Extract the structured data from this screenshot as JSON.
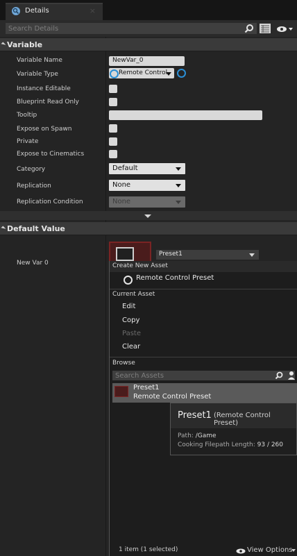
{
  "tab": {
    "label": "Details",
    "close": "×"
  },
  "search": {
    "placeholder": "Search Details"
  },
  "variable_section": {
    "title": "Variable",
    "rows": {
      "variable_name": {
        "label": "Variable Name",
        "value": "NewVar_0"
      },
      "variable_type": {
        "label": "Variable Type",
        "value": "Remote Control"
      },
      "instance_editable": {
        "label": "Instance Editable"
      },
      "blueprint_read_only": {
        "label": "Blueprint Read Only"
      },
      "tooltip": {
        "label": "Tooltip",
        "value": ""
      },
      "expose_on_spawn": {
        "label": "Expose on Spawn"
      },
      "private": {
        "label": "Private"
      },
      "expose_to_cinematics": {
        "label": "Expose to Cinematics"
      },
      "category": {
        "label": "Category",
        "value": "Default"
      },
      "replication": {
        "label": "Replication",
        "value": "None"
      },
      "replication_condition": {
        "label": "Replication Condition",
        "value": "None"
      }
    }
  },
  "default_value_section": {
    "title": "Default Value",
    "new_var": {
      "label": "New Var 0",
      "asset": "Preset1"
    }
  },
  "menu": {
    "create_new_asset": {
      "title": "Create New Asset",
      "item": "Remote Control Preset"
    },
    "current_asset": {
      "title": "Current Asset",
      "items": {
        "edit": "Edit",
        "copy": "Copy",
        "paste": "Paste",
        "clear": "Clear"
      }
    },
    "browse": {
      "title": "Browse",
      "search_placeholder": "Search Assets",
      "result": {
        "name": "Preset1",
        "type": "Remote Control Preset"
      }
    },
    "tooltip": {
      "title": "Preset1",
      "type": "(Remote Control Preset)",
      "path_label": "Path:",
      "path_value": "/Game",
      "cook_label": "Cooking Filepath Length:",
      "cook_value": "93 / 260"
    },
    "footer": {
      "status": "1 item (1 selected)",
      "view_options": "View Options"
    }
  },
  "colors": {
    "accent_blue": "#2a8fd6",
    "preset_red": "#7a2424",
    "panel_bg": "#242424"
  },
  "icons": [
    "details-icon",
    "search-icon",
    "grid-icon",
    "eye-icon",
    "circle-icon",
    "person-icon"
  ]
}
